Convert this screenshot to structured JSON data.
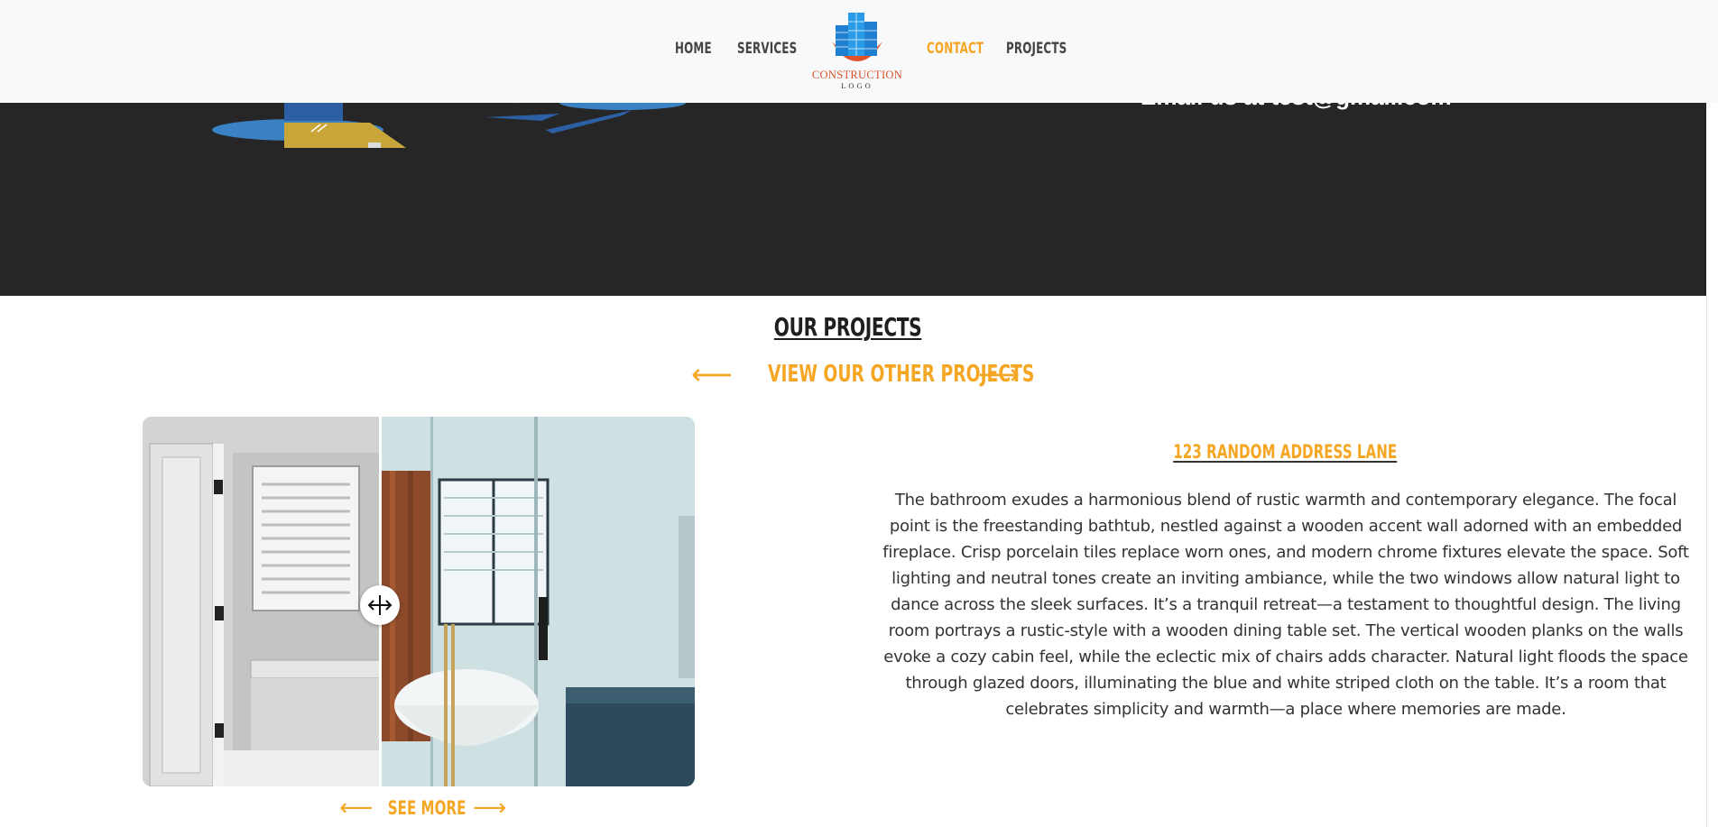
{
  "nav": {
    "items": [
      {
        "label": "HOME"
      },
      {
        "label": "SERVICES"
      },
      {
        "label": "CONTACT"
      },
      {
        "label": "PROJECTS"
      }
    ],
    "active": "CONTACT",
    "logo": {
      "line1": "CONSTRUCTION",
      "line2": "LOGO"
    }
  },
  "contact_band": {
    "email_text": "Email us at test@gmail.com"
  },
  "projects": {
    "title": "OUR PROJECTS",
    "other_label": "VIEW OUR OTHER PROJECTS",
    "see_more_label": "SEE MORE",
    "address": "123 RANDOM ADDRESS LANE",
    "description": "The bathroom exudes a harmonious blend of rustic warmth and contemporary elegance. The focal point is the freestanding bathtub, nestled against a wooden accent wall adorned with an embedded fireplace. Crisp porcelain tiles replace worn ones, and modern chrome fixtures elevate the space. Soft lighting and neutral tones create an inviting ambiance, while the two windows allow natural light to dance across the sleek surfaces. It’s a tranquil retreat—a testament to thoughtful design. The living room portrays a rustic-style with a wooden dining table set. The vertical wooden planks on the walls evoke a cozy cabin feel, while the eclectic mix of chairs adds character. Natural light floods the space through glazed doors, illuminating the blue and white striped cloth on the table. It’s a room that celebrates simplicity and warmth—a place where memories are made."
  },
  "colors": {
    "accent": "#f5a623",
    "dark_band": "#262626",
    "header_bg": "#f8f9fa"
  },
  "icons": [
    "arrow-left-icon",
    "arrow-right-icon",
    "drag-handle-icon",
    "building-logo-icon"
  ]
}
